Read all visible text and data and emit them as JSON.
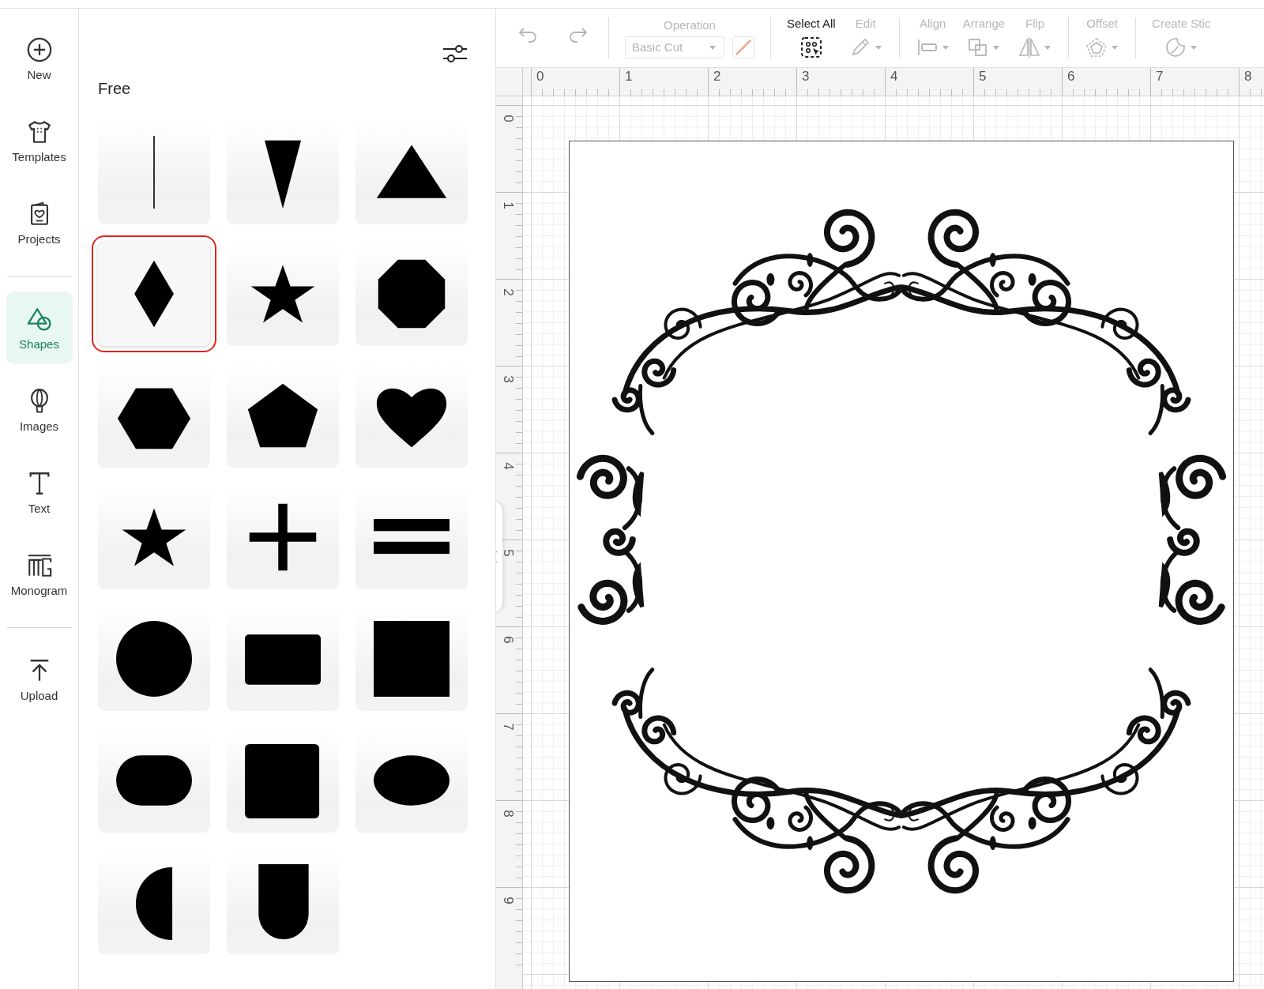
{
  "nav": {
    "groups": [
      [
        {
          "label": "New",
          "selected": false
        },
        {
          "label": "Templates",
          "selected": false
        },
        {
          "label": "Projects",
          "selected": false
        }
      ],
      [
        {
          "label": "Shapes",
          "selected": true
        },
        {
          "label": "Images",
          "selected": false
        },
        {
          "label": "Text",
          "selected": false
        },
        {
          "label": "Monogram",
          "selected": false
        }
      ],
      [
        {
          "label": "Upload",
          "selected": false
        }
      ]
    ]
  },
  "shapes_panel": {
    "section_title": "Free",
    "shapes": [
      {
        "kind": "line",
        "selected": false
      },
      {
        "kind": "triangle-down",
        "selected": false
      },
      {
        "kind": "triangle",
        "selected": false
      },
      {
        "kind": "diamond",
        "selected": true
      },
      {
        "kind": "star",
        "selected": false
      },
      {
        "kind": "octagon",
        "selected": false
      },
      {
        "kind": "hexagon",
        "selected": false
      },
      {
        "kind": "pentagon",
        "selected": false
      },
      {
        "kind": "heart",
        "selected": false
      },
      {
        "kind": "star",
        "selected": false
      },
      {
        "kind": "plus",
        "selected": false
      },
      {
        "kind": "equals",
        "selected": false
      },
      {
        "kind": "circle",
        "selected": false
      },
      {
        "kind": "rounded-rectangle",
        "selected": false
      },
      {
        "kind": "square",
        "selected": false
      },
      {
        "kind": "pill",
        "selected": false
      },
      {
        "kind": "rounded-square",
        "selected": false
      },
      {
        "kind": "ellipse",
        "selected": false
      },
      {
        "kind": "half-circle",
        "selected": false
      },
      {
        "kind": "arch",
        "selected": false
      }
    ]
  },
  "toolbar": {
    "items": [
      {
        "kind": "icon-button",
        "disabled": true
      },
      {
        "kind": "icon-button",
        "disabled": true
      },
      {
        "kind": "divider"
      },
      {
        "kind": "select",
        "label": "Operation",
        "value": "Basic Cut",
        "disabled": true
      },
      {
        "kind": "divider"
      },
      {
        "kind": "menu",
        "label": "Select All",
        "disabled": false,
        "dropdown": false
      },
      {
        "kind": "menu",
        "label": "Edit",
        "disabled": true,
        "dropdown": true
      },
      {
        "kind": "divider"
      },
      {
        "kind": "menu",
        "label": "Align",
        "disabled": true,
        "dropdown": true
      },
      {
        "kind": "menu",
        "label": "Arrange",
        "disabled": true,
        "dropdown": true
      },
      {
        "kind": "menu",
        "label": "Flip",
        "disabled": true,
        "dropdown": true
      },
      {
        "kind": "divider"
      },
      {
        "kind": "menu",
        "label": "Offset",
        "disabled": true,
        "dropdown": true
      },
      {
        "kind": "divider"
      },
      {
        "kind": "menu",
        "label": "Create Stic",
        "disabled": true,
        "dropdown": true
      }
    ]
  },
  "ruler": {
    "horizontal": [
      "0",
      "1",
      "2",
      "3",
      "4",
      "5",
      "6",
      "7",
      "8"
    ],
    "vertical": [
      "0",
      "1",
      "2",
      "3",
      "4",
      "5",
      "6",
      "7",
      "8",
      "9"
    ]
  }
}
